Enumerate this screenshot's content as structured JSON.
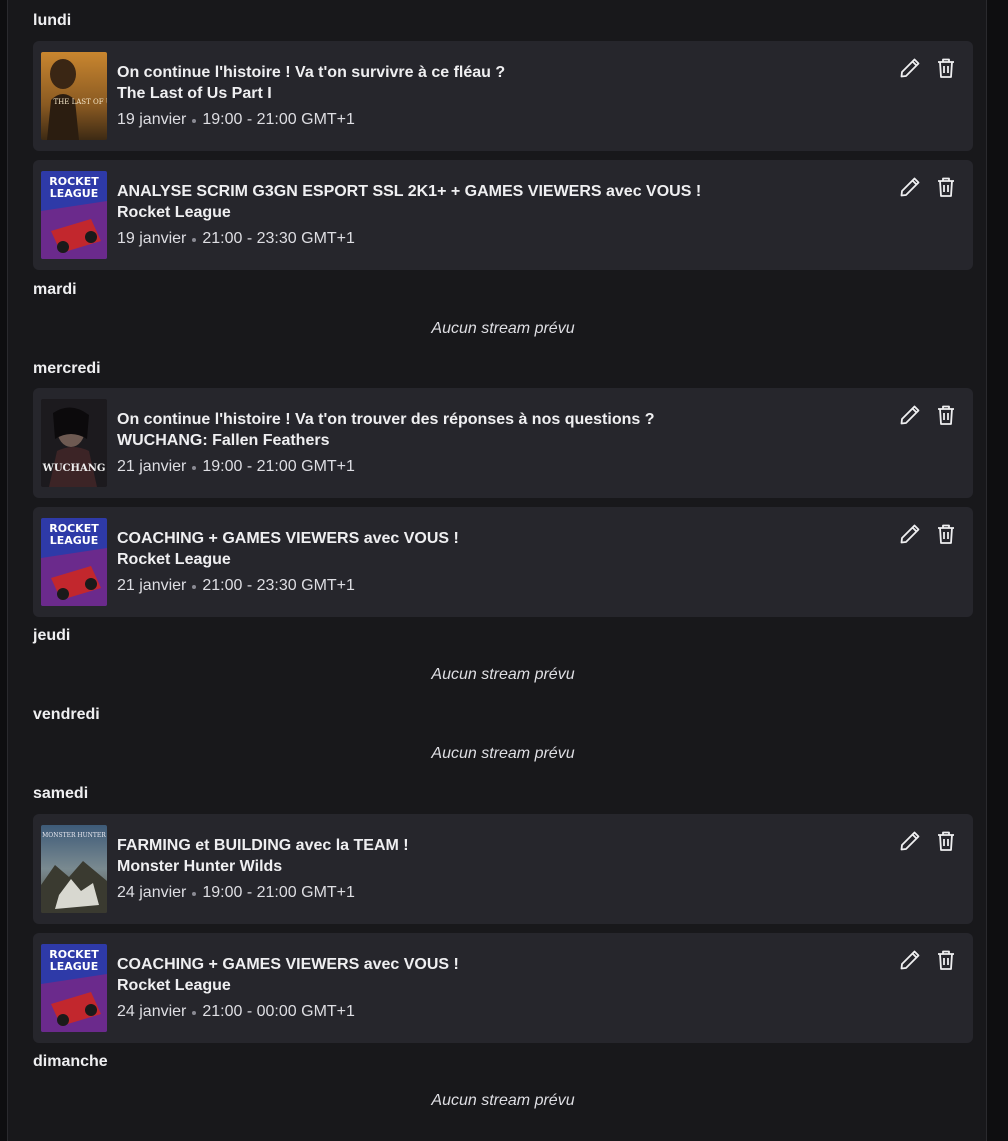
{
  "days": [
    {
      "label": "lundi"
    },
    {
      "label": "mardi"
    },
    {
      "label": "mercredi"
    },
    {
      "label": "jeudi"
    },
    {
      "label": "vendredi"
    },
    {
      "label": "samedi"
    },
    {
      "label": "dimanche"
    }
  ],
  "empty_text": "Aucun stream prévu",
  "streams": [
    {
      "title": "On continue l'histoire ! Va t'on survivre à ce fléau ?",
      "game": "The Last of Us Part I",
      "date": "19 janvier",
      "time": "19:00 - 21:00 GMT+1",
      "thumb": "last-of-us"
    },
    {
      "title": "ANALYSE SCRIM G3GN ESPORT SSL 2K1+ + GAMES VIEWERS avec VOUS !",
      "game": "Rocket League",
      "date": "19 janvier",
      "time": "21:00 - 23:30 GMT+1",
      "thumb": "rocket-league"
    },
    {
      "title": "On continue l'histoire ! Va t'on trouver des réponses à nos questions ?",
      "game": "WUCHANG: Fallen Feathers",
      "date": "21 janvier",
      "time": "19:00 - 21:00 GMT+1",
      "thumb": "wuchang"
    },
    {
      "title": "COACHING + GAMES VIEWERS avec VOUS !",
      "game": "Rocket League",
      "date": "21 janvier",
      "time": "21:00 - 23:30 GMT+1",
      "thumb": "rocket-league"
    },
    {
      "title": "FARMING et BUILDING avec la TEAM !",
      "game": "Monster Hunter Wilds",
      "date": "24 janvier",
      "time": "19:00 - 21:00 GMT+1",
      "thumb": "monster-hunter"
    },
    {
      "title": "COACHING + GAMES VIEWERS avec VOUS !",
      "game": "Rocket League",
      "date": "24 janvier",
      "time": "21:00 - 00:00 GMT+1",
      "thumb": "rocket-league"
    }
  ],
  "thumb_text": {
    "rocket-league": [
      "ROCKET",
      "LEAGUE"
    ],
    "last-of-us": [
      "THE LAST OF US"
    ],
    "wuchang": [
      "WUCHANG"
    ],
    "monster-hunter": [
      "MONSTER HUNTER"
    ]
  },
  "icons": {
    "edit": "pencil-icon",
    "delete": "trash-icon"
  },
  "colors": {
    "background": "#18181b",
    "card": "#26262c",
    "text": "#efeff1"
  }
}
